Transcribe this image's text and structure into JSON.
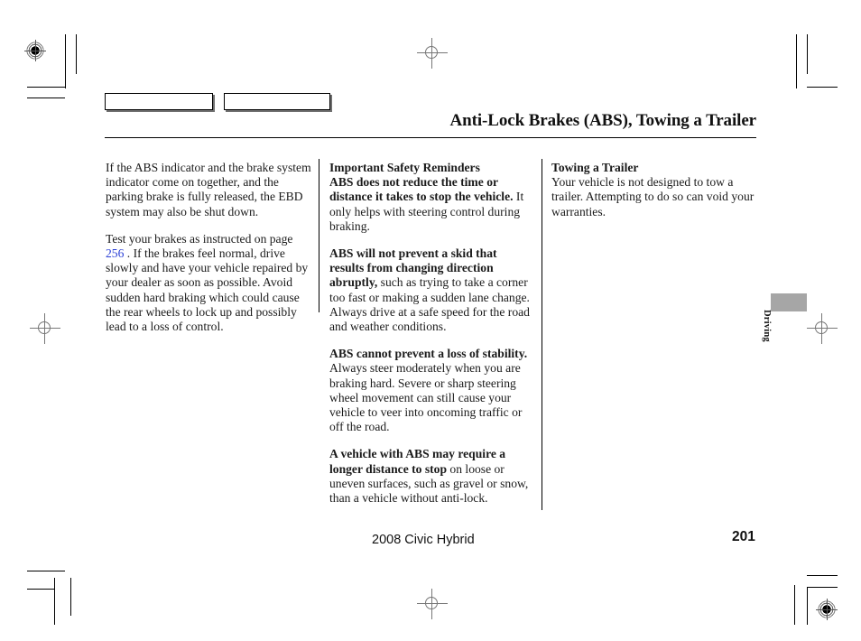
{
  "document": {
    "title": "Anti-Lock Brakes (ABS), Towing a Trailer",
    "footer": {
      "model": "2008  Civic  Hybrid",
      "page_number": "201"
    },
    "side_tab": {
      "label": "Driving",
      "color": "#a6a6a6"
    },
    "link_color": "#2a3fd6"
  },
  "nav": {
    "button_left_label": "",
    "button_right_label": ""
  },
  "columns": {
    "column1": {
      "paragraphs": [
        {
          "runs": [
            {
              "text": "If the ABS indicator and the brake system indicator come on together, and the parking brake is fully released, the EBD system may also be shut down.",
              "style": "normal"
            }
          ]
        },
        {
          "runs": [
            {
              "text": "Test your brakes as instructed on page ",
              "style": "normal"
            },
            {
              "text": "256",
              "style": "link"
            },
            {
              "text": " . If the brakes feel normal, drive slowly and have your vehicle repaired by your dealer as soon as possible. Avoid sudden hard braking which could cause the rear wheels to lock up and possibly lead to a loss of control.",
              "style": "normal"
            }
          ]
        }
      ]
    },
    "column2": {
      "heading": "Important Safety Reminders",
      "paragraphs": [
        {
          "runs": [
            {
              "text": "ABS does not reduce the time or distance it takes to stop the vehicle.",
              "style": "bold"
            },
            {
              "text": " It only helps with steering control during braking.",
              "style": "normal"
            }
          ]
        },
        {
          "runs": [
            {
              "text": "ABS will not prevent a skid that results from changing direction abruptly,",
              "style": "bold"
            },
            {
              "text": " such as trying to take a corner too fast or making a sudden lane change. Always drive at a safe speed for the road and weather conditions.",
              "style": "normal"
            }
          ]
        },
        {
          "runs": [
            {
              "text": "ABS cannot prevent a loss of stability.",
              "style": "bold"
            },
            {
              "text": " Always steer moderately when you are braking hard. Severe or sharp steering wheel movement can still cause your vehicle to veer into oncoming traffic or off the road.",
              "style": "normal"
            }
          ]
        },
        {
          "runs": [
            {
              "text": "A vehicle with ABS may require a longer distance to stop",
              "style": "bold"
            },
            {
              "text": " on loose or uneven surfaces, such as gravel or snow, than a vehicle without anti-lock.",
              "style": "normal"
            }
          ]
        }
      ]
    },
    "column3": {
      "heading": "Towing a Trailer",
      "paragraphs": [
        {
          "runs": [
            {
              "text": "Your vehicle is not designed to tow a trailer. Attempting to do so can void your warranties.",
              "style": "normal"
            }
          ]
        }
      ]
    }
  }
}
